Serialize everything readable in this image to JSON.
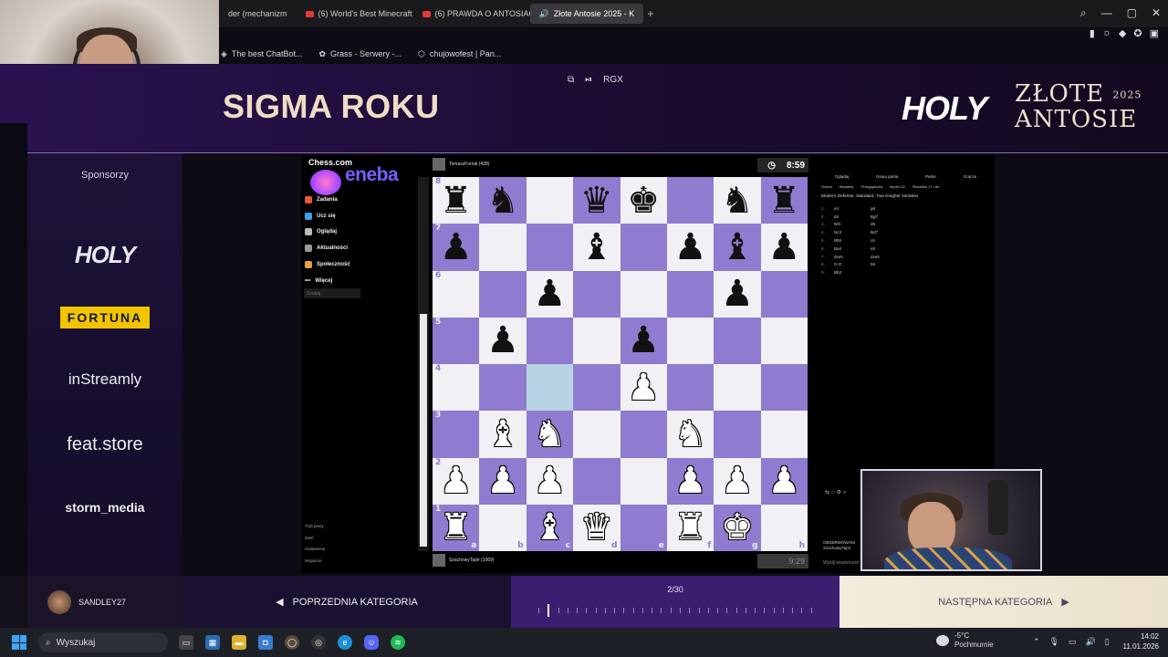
{
  "browser": {
    "tabs": [
      {
        "label": "der (mechanizm",
        "icon": "",
        "active": false
      },
      {
        "label": "(6) World's Best Minecraft",
        "icon": "youtube-icon",
        "active": false
      },
      {
        "label": "(6) PRAWDA O ANTOSIACH",
        "icon": "youtube-icon",
        "active": false
      },
      {
        "label": "Złote Antosie 2025 - K",
        "icon": "speaker-icon",
        "active": true
      }
    ],
    "bookmarks": [
      "The best ChatBot...",
      "Grass - Serwery -...",
      "chujowofest | Pan..."
    ],
    "tools_label": "RGX"
  },
  "overlay": {
    "category_title": "SIGMA ROKU",
    "brand_logo": "HOLY",
    "event_title_line1": "ZŁOTE",
    "event_title_line2": "ANTOSIE",
    "event_year": "2025",
    "sponsors_title": "Sponsorzy",
    "sponsors": [
      "HOLY",
      "FORTUNA",
      "inStreamly",
      "feat.store",
      "storm_media"
    ],
    "streamer_name": "SANDLEY27",
    "prev_label": "POPRZEDNIA KATEGORIA",
    "next_label": "NASTĘPNA KATEGORIA",
    "progress_text": "2/30",
    "progress": {
      "current": 2,
      "total": 30
    },
    "gx_label": "GX"
  },
  "chess": {
    "site_logo": "Chess.com",
    "sponsor_banner": "eneba",
    "nav": [
      "Zadania",
      "Ucz się",
      "Oglądaj",
      "Aktualności",
      "Społeczność",
      "Więcej"
    ],
    "search_placeholder": "Szukaj",
    "bottom_links": [
      "Tryb jasny",
      "Zwiń",
      "Ustawienia",
      "Wsparcie"
    ],
    "player_top": "TomaszFornal (428)",
    "player_bottom": "SzachowyTapir (1069)",
    "clock_top": "8:59",
    "clock_bottom": "9:29",
    "board": [
      [
        "r",
        "n",
        "",
        "q",
        "k",
        "",
        "n",
        "r"
      ],
      [
        "p",
        "",
        "",
        "b",
        "",
        "p",
        "b",
        "p"
      ],
      [
        "",
        "",
        "p",
        "",
        "",
        "",
        "p",
        ""
      ],
      [
        "",
        "p",
        "",
        "",
        "p",
        "",
        "",
        ""
      ],
      [
        "",
        "",
        "",
        "",
        "P",
        "",
        "",
        ""
      ],
      [
        "",
        "B",
        "N",
        "",
        "",
        "N",
        "",
        ""
      ],
      [
        "P",
        "P",
        "P",
        "",
        "",
        "P",
        "P",
        "P"
      ],
      [
        "R",
        "",
        "B",
        "Q",
        "",
        "R",
        "K",
        ""
      ]
    ],
    "highlight": "c4",
    "ranks": [
      "8",
      "7",
      "6",
      "5",
      "4",
      "3",
      "2",
      "1"
    ],
    "files": [
      "a",
      "b",
      "c",
      "d",
      "e",
      "f",
      "g",
      "h"
    ],
    "analysis": {
      "tabs": [
        "Oglądaj",
        "Nowa partia",
        "Partie",
        "Gracze"
      ],
      "options": [
        "Ocena",
        "Warianty",
        "Przeglądarka",
        "depth=22",
        "Stockfish 17 Lite"
      ],
      "opening": "Modern Defense: Standard, Two Knights Variation",
      "moves": [
        {
          "n": "1.",
          "w": "e4",
          "b": "g6"
        },
        {
          "n": "2.",
          "w": "d4",
          "b": "Bg7"
        },
        {
          "n": "3.",
          "w": "Nf3",
          "b": "d6"
        },
        {
          "n": "4.",
          "w": "Nc3",
          "b": "Bd7"
        },
        {
          "n": "5.",
          "w": "Bb5",
          "b": "c6"
        },
        {
          "n": "6.",
          "w": "Ba4",
          "b": "e5"
        },
        {
          "n": "7.",
          "w": "dxe5",
          "b": "dxe5"
        },
        {
          "n": "8.",
          "w": "O-O",
          "b": "b5"
        },
        {
          "n": "9.",
          "w": "Bb3",
          "b": ""
        }
      ]
    },
    "watching_label": "OBSERWOWANI",
    "watching_user": "SzachowyTapir",
    "chat_placeholder": "Wyślij wiadomość"
  },
  "taskbar": {
    "search_placeholder": "Wyszukaj",
    "weather_temp": "-5°C",
    "weather_desc": "Pochmurnie",
    "time": "14:02",
    "date": "11.01.2026"
  }
}
